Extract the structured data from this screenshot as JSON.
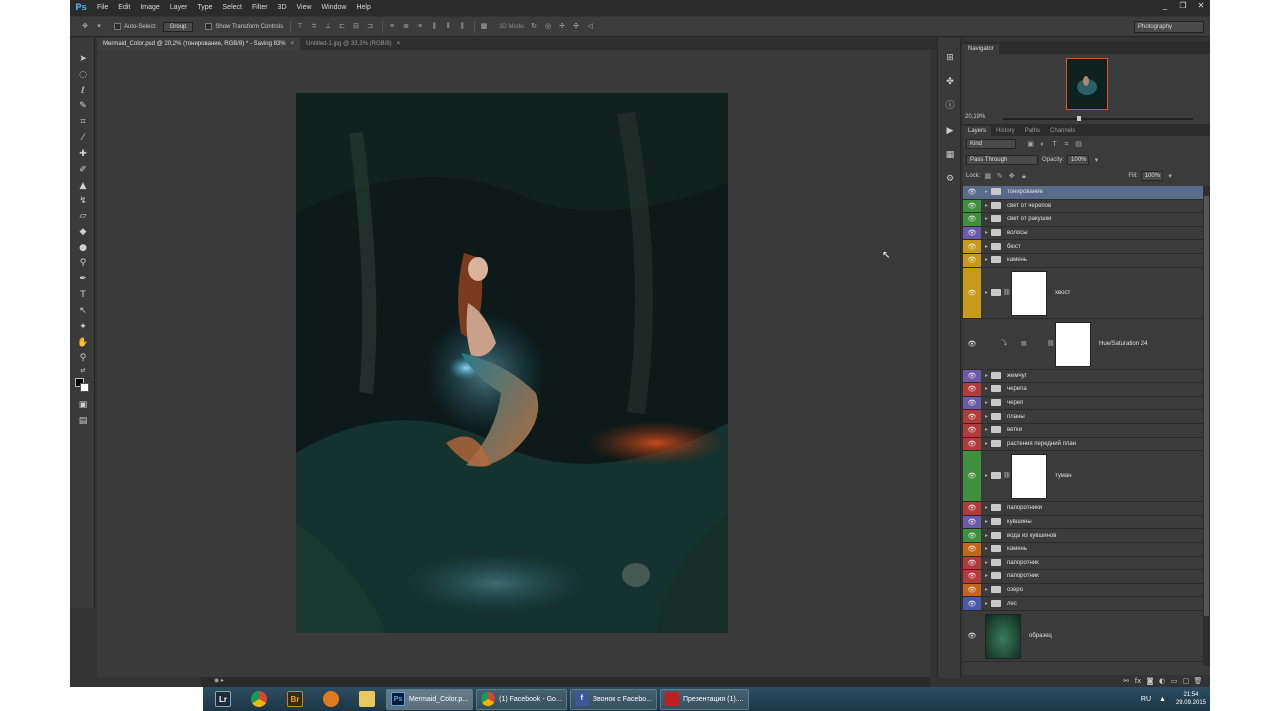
{
  "app": {
    "logo": "Ps",
    "menu": [
      "File",
      "Edit",
      "Image",
      "Layer",
      "Type",
      "Select",
      "Filter",
      "3D",
      "View",
      "Window",
      "Help"
    ],
    "window_controls": [
      "_",
      "❐",
      "✕"
    ],
    "workspace": "Photography"
  },
  "options_bar": {
    "auto_select_label": "Auto-Select:",
    "auto_select_target": "Group",
    "transform_controls_label": "Show Transform Controls",
    "mode_3d_label": "3D Mode:"
  },
  "doc_tabs": [
    {
      "title": "Mermaid_Color.psd @ 20,2% (тонирование, RGB/8) * - Saving 83%",
      "close": "×",
      "active": true
    },
    {
      "title": "Untitled-1.jpg @ 33,3% (RGB/8)",
      "close": "×",
      "active": false
    }
  ],
  "colors": {
    "foreground": "#000000",
    "background": "#ffffff",
    "selected_layer": "#5a6a8a"
  },
  "navigator": {
    "tab": "Navigator",
    "zoom": "20,19%"
  },
  "layers_panel": {
    "tabs": [
      "Layers",
      "History",
      "Paths",
      "Channels"
    ],
    "filter_kind": "Kind",
    "blend_mode": "Pass Through",
    "opacity_label": "Opacity:",
    "opacity": "100%",
    "lock_label": "Lock:",
    "fill_label": "Fill:",
    "fill": "100%"
  },
  "layers": [
    {
      "name": "тонирование",
      "color": "none",
      "kind": "group",
      "selected": true
    },
    {
      "name": "свет от черепов",
      "color": "#3f8f3f",
      "kind": "group"
    },
    {
      "name": "свет от ракушки",
      "color": "#3f8f3f",
      "kind": "group"
    },
    {
      "name": "волосы",
      "color": "#6a5aa8",
      "kind": "group"
    },
    {
      "name": "бюст",
      "color": "#c89a1a",
      "kind": "group"
    },
    {
      "name": "камень",
      "color": "#c89a1a",
      "kind": "group"
    },
    {
      "name": "хвост",
      "color": "#c89a1a",
      "kind": "group-masked"
    },
    {
      "name": "Hue/Saturation 24",
      "color": "none",
      "kind": "adjustment"
    },
    {
      "name": "жемчуг",
      "color": "#6a5aa8",
      "kind": "group"
    },
    {
      "name": "черепа",
      "color": "#b33a3a",
      "kind": "group"
    },
    {
      "name": "череп",
      "color": "#6a5aa8",
      "kind": "group"
    },
    {
      "name": "планы",
      "color": "#b33a3a",
      "kind": "group"
    },
    {
      "name": "ветки",
      "color": "#b33a3a",
      "kind": "group"
    },
    {
      "name": "растения передний план",
      "color": "#b33a3a",
      "kind": "group"
    },
    {
      "name": "туман",
      "color": "#3f8f3f",
      "kind": "group-masked"
    },
    {
      "name": "папоротники",
      "color": "#b33a3a",
      "kind": "group"
    },
    {
      "name": "кувшины",
      "color": "#6a5aa8",
      "kind": "group"
    },
    {
      "name": "вода из кувшинов",
      "color": "#3f8f3f",
      "kind": "group"
    },
    {
      "name": "камень",
      "color": "#c8641a",
      "kind": "group"
    },
    {
      "name": "папоротник",
      "color": "#b33a3a",
      "kind": "group"
    },
    {
      "name": "папоротник",
      "color": "#b33a3a",
      "kind": "group"
    },
    {
      "name": "озеро",
      "color": "#c8641a",
      "kind": "group"
    },
    {
      "name": "лес",
      "color": "#4a5aa8",
      "kind": "group"
    },
    {
      "name": "образец",
      "color": "none",
      "kind": "image"
    }
  ],
  "taskbar": {
    "apps": [
      {
        "icon": "lightroom-icon",
        "label": "Lr"
      },
      {
        "icon": "chrome-icon",
        "label": ""
      },
      {
        "icon": "bridge-icon",
        "label": "Br"
      },
      {
        "icon": "settings-app-icon",
        "label": ""
      },
      {
        "icon": "file-explorer-icon",
        "label": ""
      }
    ],
    "tasks": [
      {
        "icon": "photoshop-icon",
        "icon_text": "Ps",
        "label": "Mermaid_Color.p...",
        "active": true
      },
      {
        "icon": "chrome-icon",
        "icon_text": "",
        "label": "(1) Facebook - Go..."
      },
      {
        "icon": "facebook-icon",
        "icon_text": "f",
        "label": "Звонок с Facebo..."
      },
      {
        "icon": "pdf-icon",
        "icon_text": "",
        "label": "Презентация (1)...."
      }
    ],
    "lang": "RU",
    "tray_up": "▲",
    "time": "21:54",
    "date": "29.09.2015"
  }
}
